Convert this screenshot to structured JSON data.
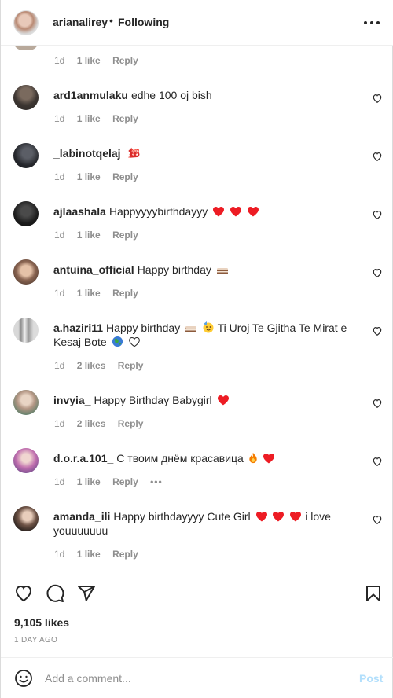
{
  "header": {
    "username": "arianalirey",
    "separator": "•",
    "follow_label": "Following"
  },
  "top_meta": {
    "time": "1d",
    "likes": "1 like",
    "reply": "Reply"
  },
  "comments": [
    {
      "username": "ard1anmulaku",
      "text": "edhe 100 oj bish",
      "time": "1d",
      "likes": "1 like",
      "reply": "Reply",
      "emoji": []
    },
    {
      "username": "_labinotqelaj",
      "text": "",
      "time": "1d",
      "likes": "1 like",
      "reply": "Reply",
      "emoji": [
        "hundred"
      ]
    },
    {
      "username": "ajlaashala",
      "text": "Happyyyybirthdayyy",
      "time": "1d",
      "likes": "1 like",
      "reply": "Reply",
      "emoji": [
        "red-heart",
        "red-heart",
        "red-heart"
      ]
    },
    {
      "username": "antuina_official",
      "text": "Happy birthday",
      "time": "1d",
      "likes": "1 like",
      "reply": "Reply",
      "emoji": [
        "cake"
      ]
    },
    {
      "username": "a.haziri11",
      "text": "Happy birthday",
      "text2": "Ti Uroj Te Gjitha Te Mirat e",
      "text3": "Kesaj Bote",
      "time": "1d",
      "likes": "2 likes",
      "reply": "Reply",
      "emoji": [
        "cake",
        "partying-face",
        "globe",
        "white-heart"
      ]
    },
    {
      "username": "invyia_",
      "text": "Happy Birthday Babygirl",
      "time": "1d",
      "likes": "2 likes",
      "reply": "Reply",
      "emoji": [
        "red-heart"
      ]
    },
    {
      "username": "d.o.r.a.101_",
      "text": "С твоим днём красавица",
      "time": "1d",
      "likes": "1 like",
      "reply": "Reply",
      "more": "•••",
      "emoji": [
        "fire",
        "red-heart"
      ]
    },
    {
      "username": "amanda_ili",
      "text": "Happy birthdayyyy Cute Girl",
      "text2": "i love",
      "text3": "youuuuuuu",
      "time": "1d",
      "likes": "1 like",
      "reply": "Reply",
      "emoji": [
        "red-heart",
        "red-heart",
        "red-heart"
      ]
    }
  ],
  "post": {
    "likes": "9,105 likes",
    "time_ago": "1 DAY AGO"
  },
  "add_comment": {
    "placeholder": "Add a comment...",
    "post_label": "Post"
  },
  "colors": {
    "text": "#262626",
    "secondary": "#8e8e8e",
    "post_disabled": "#b2dffc",
    "heart_red": "#ed1c24"
  }
}
